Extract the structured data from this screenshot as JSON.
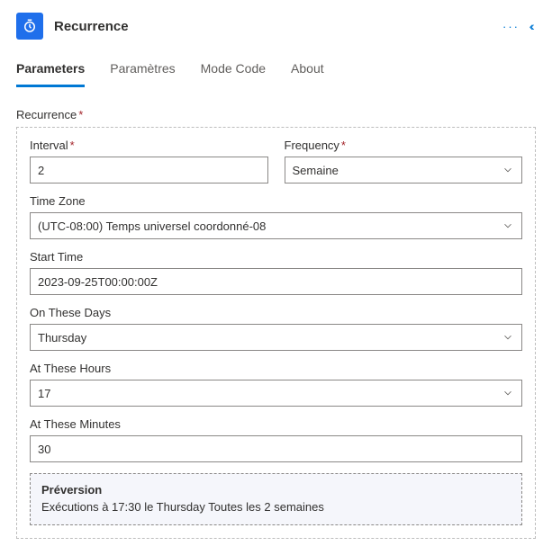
{
  "header": {
    "title": "Recurrence"
  },
  "tabs": [
    {
      "label": "Parameters"
    },
    {
      "label": "Paramètres"
    },
    {
      "label": "Mode Code"
    },
    {
      "label": "About"
    }
  ],
  "section": {
    "title": "Recurrence"
  },
  "fields": {
    "interval": {
      "label": "Interval",
      "value": "2"
    },
    "frequency": {
      "label": "Frequency",
      "value": "Semaine"
    },
    "timezone": {
      "label": "Time Zone",
      "value": "(UTC-08:00) Temps universel coordonné-08"
    },
    "startTime": {
      "label": "Start Time",
      "value": "2023-09-25T00:00:00Z"
    },
    "onDays": {
      "label": "On These Days",
      "value": "Thursday"
    },
    "atHours": {
      "label": "At These Hours",
      "value": "17"
    },
    "atMinutes": {
      "label": "At These Minutes",
      "value": "30"
    }
  },
  "preview": {
    "title": "Préversion",
    "text": "Exécutions à 17:30 le Thursday Toutes les 2 semaines"
  }
}
